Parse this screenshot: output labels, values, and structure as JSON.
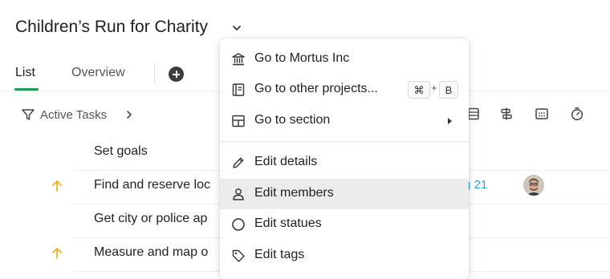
{
  "project": {
    "title": "Children’s Run for Charity"
  },
  "tabs": [
    {
      "label": "List",
      "active": true
    },
    {
      "label": "Overview",
      "active": false
    }
  ],
  "filter": {
    "label": "Active Tasks"
  },
  "toolbar": {
    "icons": [
      "board-icon",
      "timeline-icon",
      "calendar-icon",
      "stopwatch-icon"
    ]
  },
  "tasks": [
    {
      "label": "Set goals",
      "priority": false
    },
    {
      "label": "Find and reserve loc",
      "priority": true,
      "due": "g 21",
      "has_avatar": true
    },
    {
      "label": "Get city or police ap",
      "priority": false
    },
    {
      "label": "Measure and map o",
      "priority": true
    }
  ],
  "menu": {
    "items": [
      {
        "label": "Go to Mortus Inc",
        "icon": "building-icon"
      },
      {
        "label": "Go to other projects...",
        "icon": "projects-icon",
        "shortcut": [
          "⌘",
          "+",
          "B"
        ]
      },
      {
        "label": "Go to section",
        "icon": "section-icon",
        "submenu": true
      },
      {
        "label": "Edit details",
        "icon": "pencil-icon"
      },
      {
        "label": "Edit members",
        "icon": "person-icon",
        "highlighted": true
      },
      {
        "label": "Edit statues",
        "icon": "circle-icon"
      },
      {
        "label": "Edit tags",
        "icon": "tag-icon"
      }
    ]
  },
  "colors": {
    "accent_green": "#1f9d55",
    "priority_yellow": "#f2b21b",
    "due_blue": "#2aa6d3",
    "highlight": "#ececec"
  }
}
